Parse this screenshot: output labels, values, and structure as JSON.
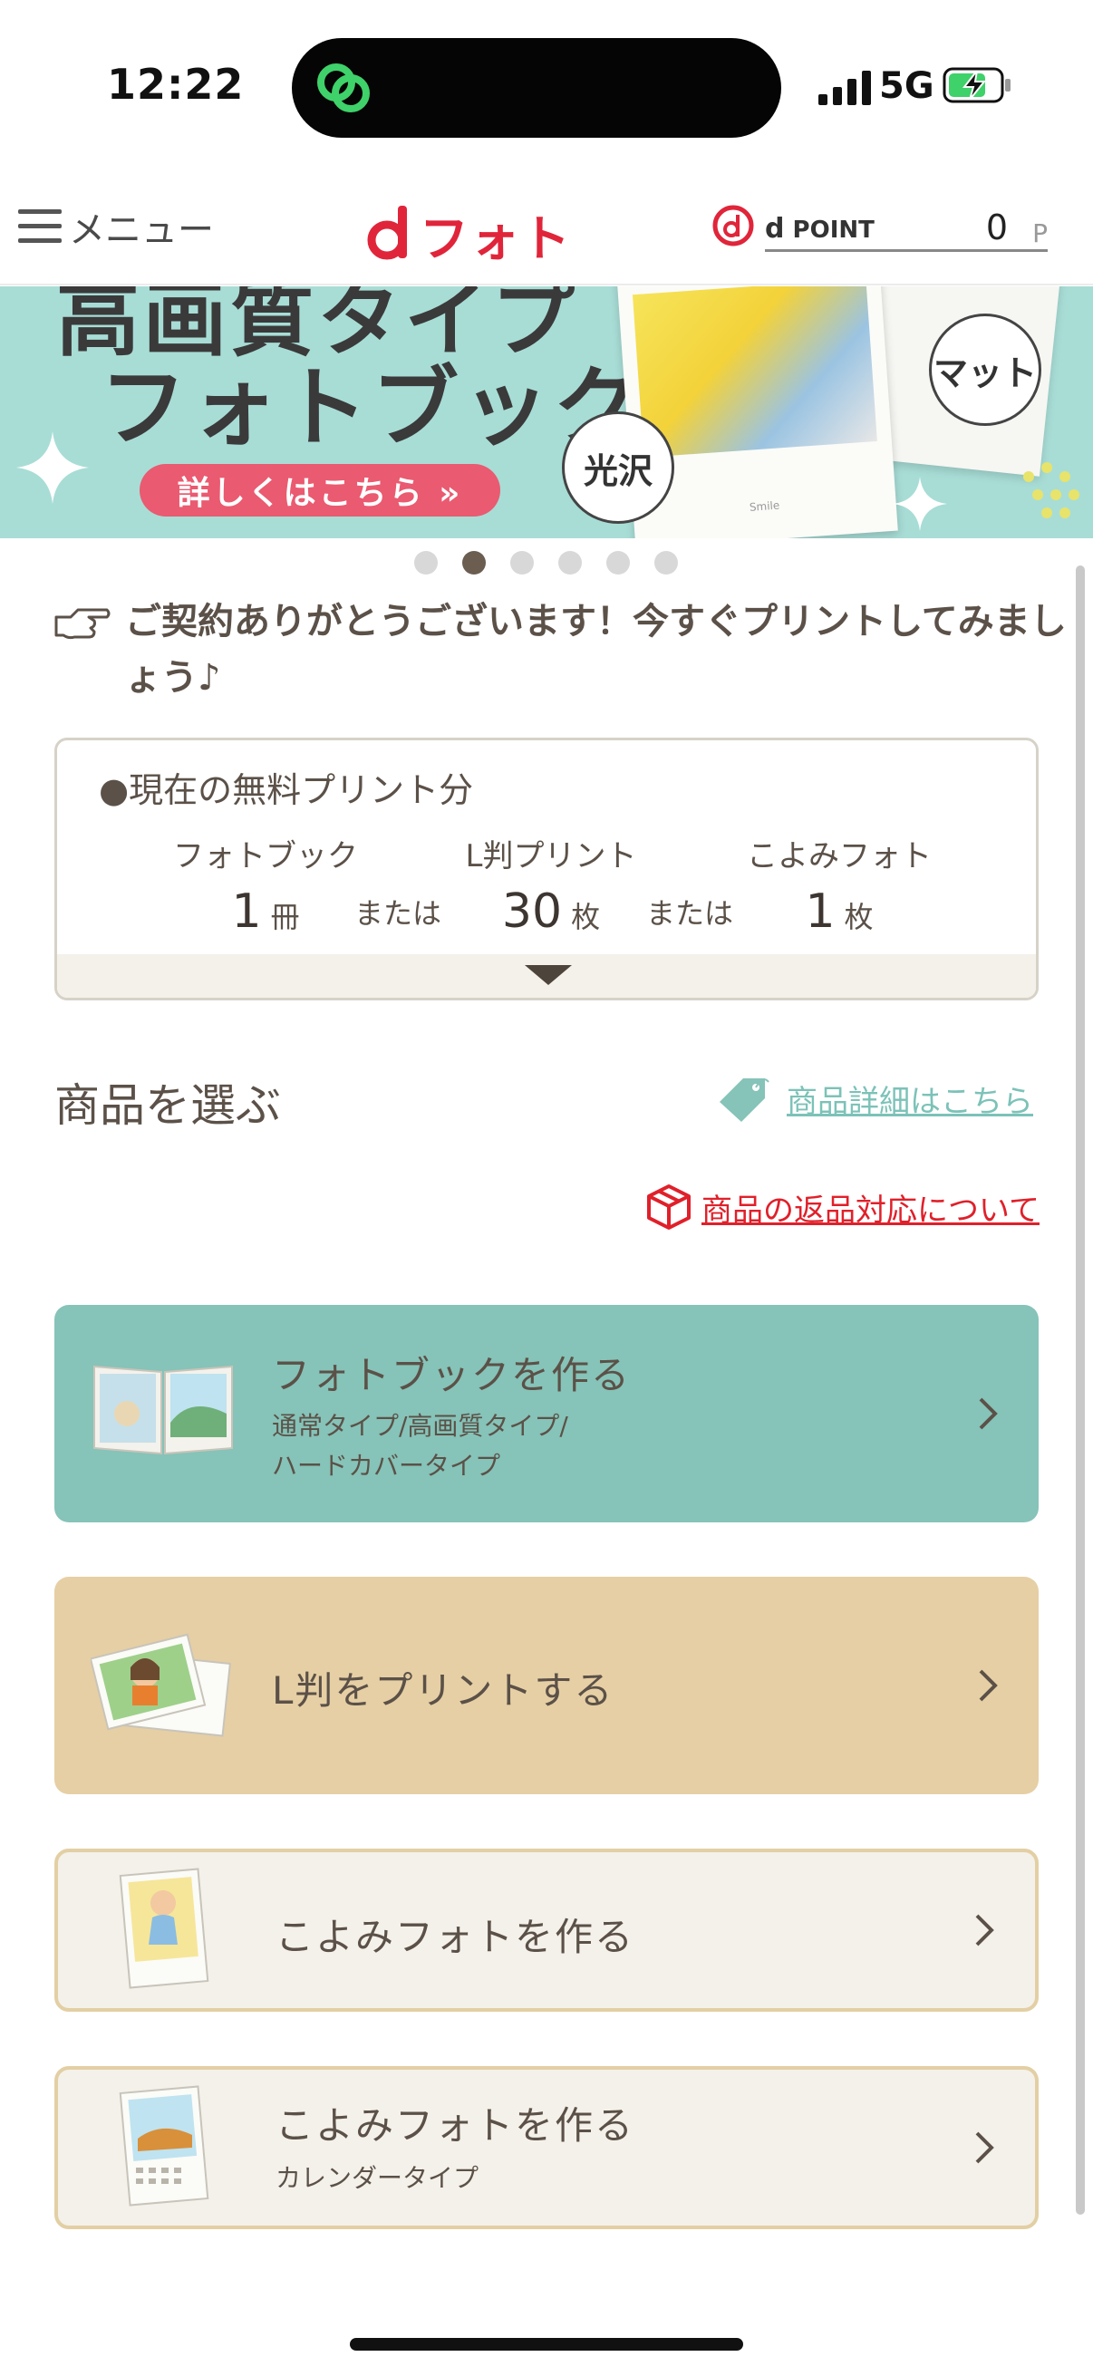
{
  "status_bar": {
    "time": "12:22",
    "network": "5G"
  },
  "header": {
    "menu_label": "メニュー",
    "logo_text": "フォト",
    "dpoint_label": "POINT",
    "dpoint_value": "0",
    "dpoint_unit": "P"
  },
  "banner": {
    "title_line1": "高画質タイプ",
    "title_line2": "フォトブック",
    "cta": "詳しくはこちら »",
    "badge_gloss": "光沢",
    "badge_matte": "マット",
    "photo_caption": "Smile",
    "carousel_total": 6,
    "carousel_active": 2
  },
  "message": "ご契約ありがとうございます！今すぐプリントしてみましょう♪",
  "free_prints": {
    "title": "●現在の無料プリント分",
    "or_label": "または",
    "items": [
      {
        "name": "フォトブック",
        "count": "1",
        "unit": "冊"
      },
      {
        "name": "L判プリント",
        "count": "30",
        "unit": "枚"
      },
      {
        "name": "こよみフォト",
        "count": "1",
        "unit": "枚"
      }
    ]
  },
  "products": {
    "heading": "商品を選ぶ",
    "detail_link": "商品詳細はこちら",
    "return_link": "商品の返品対応について",
    "cards": [
      {
        "label": "フォトブックを作る",
        "sub1": "通常タイプ/高画質タイプ/",
        "sub2": "ハードカバータイプ"
      },
      {
        "label": "L判をプリントする"
      },
      {
        "label": "こよみフォトを作る"
      },
      {
        "label": "こよみフォトを作る",
        "sub1": "カレンダータイプ"
      }
    ]
  },
  "colors": {
    "brand_red": "#e0253a",
    "teal_card": "#86c3b8",
    "sand_card": "#e6cfa4",
    "link_teal": "#7cc2b8",
    "link_red": "#e0202a"
  }
}
